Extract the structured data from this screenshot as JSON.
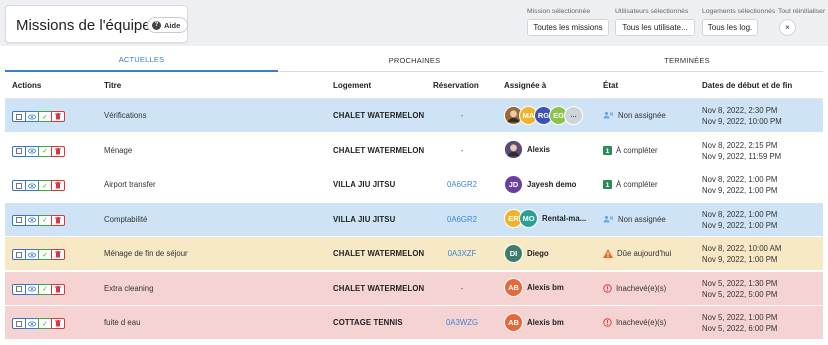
{
  "header": {
    "title": "Missions de l'équipe",
    "help_label": "Aide",
    "filters": [
      {
        "label": "Mission sélectionnée",
        "value": "Toutes les missions"
      },
      {
        "label": "Utilisateurs sélectionnés",
        "value": "Tous les utilisate..."
      },
      {
        "label": "Logements sélectionnés",
        "value": "Tous les log."
      }
    ],
    "reset_label": "Tout réinitialiser",
    "reset_icon": "×"
  },
  "tabs": [
    {
      "label": "ACTUELLES",
      "active": true
    },
    {
      "label": "PROCHAINES",
      "active": false
    },
    {
      "label": "TERMINÉES",
      "active": false
    }
  ],
  "table": {
    "columns": [
      "Actions",
      "Titre",
      "Logement",
      "Réservation",
      "Assignée à",
      "État",
      "Dates de début et de fin"
    ],
    "rows": [
      {
        "bg": "#cfe3f6",
        "titre": "Vérifications",
        "logement": "CHALET WATERMELON",
        "reservation": "-",
        "avatars": [
          {
            "initials": "",
            "color": "#9b6a3a",
            "photo": true
          },
          {
            "initials": "MA",
            "color": "#f0b429"
          },
          {
            "initials": "RG",
            "color": "#3f51b5"
          },
          {
            "initials": "EG",
            "color": "#8bc34a"
          },
          {
            "initials": "...",
            "color": "#cfd4da",
            "more": true
          }
        ],
        "assignee_name": "",
        "etat": {
          "icon": "unassigned-icon",
          "text": "Non assignée"
        },
        "date_start": "Nov 8, 2022, 2:30 PM",
        "date_end": "Nov 9, 2022, 10:00 PM"
      },
      {
        "bg": "#ffffff",
        "titre": "Ménage",
        "logement": "CHALET WATERMELON",
        "reservation": "-",
        "avatars": [
          {
            "initials": "",
            "color": "#5a4a7a",
            "photo": true
          }
        ],
        "assignee_name": "Alexis",
        "etat": {
          "icon": "todo-icon",
          "text": "À compléter"
        },
        "date_start": "Nov 8, 2022, 2:15 PM",
        "date_end": "Nov 9, 2022, 11:59 PM"
      },
      {
        "bg": "#ffffff",
        "titre": "Airport transfer",
        "logement": "VILLA JIU JITSU",
        "reservation": "0A6GR2",
        "avatars": [
          {
            "initials": "JD",
            "color": "#6a3fa0"
          }
        ],
        "assignee_name": "Jayesh demo",
        "etat": {
          "icon": "todo-icon",
          "text": "À compléter"
        },
        "date_start": "Nov 8, 2022, 1:00 PM",
        "date_end": "Nov 9, 2022, 1:00 PM"
      },
      {
        "bg": "#cfe3f6",
        "titre": "Comptabilité",
        "logement": "VILLA JIU JITSU",
        "reservation": "0A6GR2",
        "avatars": [
          {
            "initials": "ER",
            "color": "#f0b429"
          },
          {
            "initials": "MO",
            "color": "#2aa198"
          }
        ],
        "assignee_name": "Rental-ma...",
        "etat": {
          "icon": "unassigned-icon",
          "text": "Non assignée"
        },
        "date_start": "Nov 8, 2022, 1:00 PM",
        "date_end": "Nov 9, 2022, 1:00 PM"
      },
      {
        "bg": "#f7e8c6",
        "titre": "Ménage de fin de séjour",
        "logement": "CHALET WATERMELON",
        "reservation": "0A3XZF",
        "avatars": [
          {
            "initials": "DI",
            "color": "#3f7d6b"
          }
        ],
        "assignee_name": "Diego",
        "etat": {
          "icon": "warning-icon",
          "text": "Dûe aujourd'hui"
        },
        "date_start": "Nov 8, 2022, 10:00 AM",
        "date_end": "Nov 9, 2022, 1:00 PM"
      },
      {
        "bg": "#f6d3d3",
        "titre": "Extra cleaning",
        "logement": "CHALET WATERMELON",
        "reservation": "-",
        "avatars": [
          {
            "initials": "AB",
            "color": "#e5673a"
          }
        ],
        "assignee_name": "Alexis bm",
        "etat": {
          "icon": "overdue-icon",
          "text": "Inachevé(e)(s)"
        },
        "date_start": "Nov 5, 2022, 1:30 PM",
        "date_end": "Nov 5, 2022, 5:00 PM"
      },
      {
        "bg": "#f6d3d3",
        "titre": "fuite d eau",
        "logement": "COTTAGE TENNIS",
        "reservation": "0A3WZG",
        "avatars": [
          {
            "initials": "AB",
            "color": "#e5673a"
          }
        ],
        "assignee_name": "Alexis bm",
        "etat": {
          "icon": "overdue-icon",
          "text": "Inachevé(e)(s)"
        },
        "date_start": "Nov 5, 2022, 1:00 PM",
        "date_end": "Nov 5, 2022, 6:00 PM"
      }
    ]
  },
  "colors": {
    "accent": "#3a7bd5",
    "row_selected": "#cfe3f6",
    "row_due_today": "#f7e8c6",
    "row_overdue": "#f6d3d3",
    "todo_badge": "#2e8b57",
    "warning": "#e8702a",
    "overdue": "#d9363e"
  }
}
